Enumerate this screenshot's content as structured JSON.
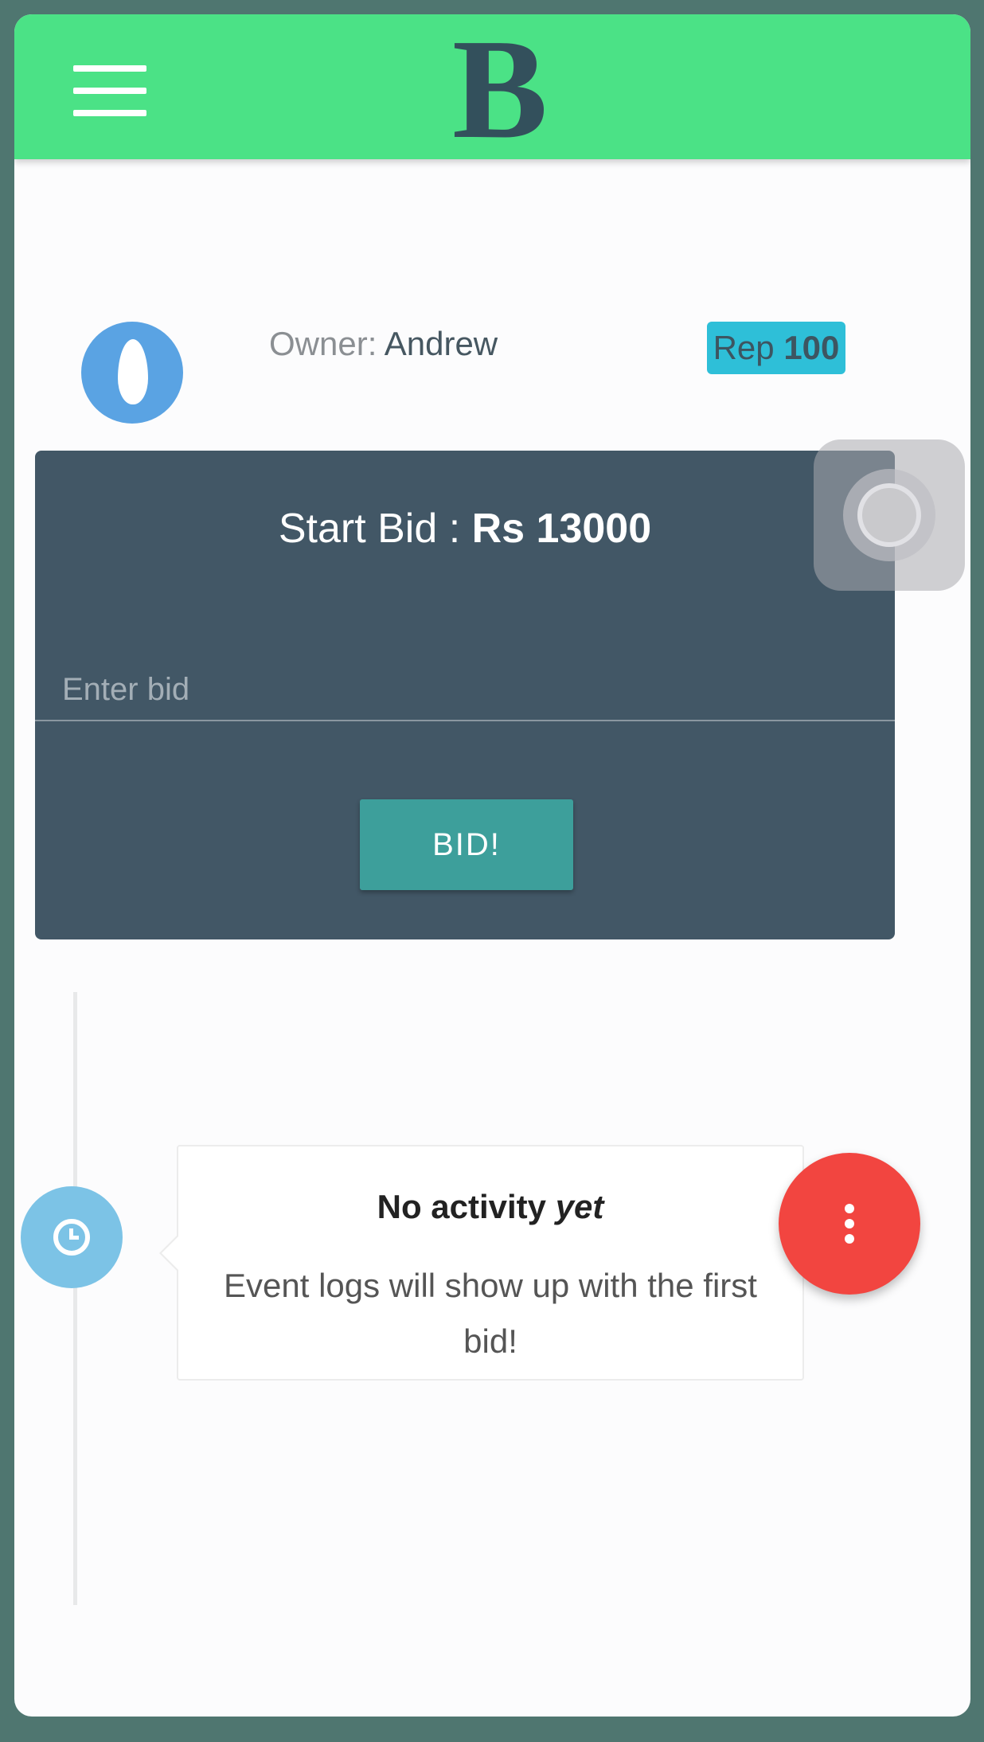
{
  "header": {
    "logo_text": "B",
    "menu_icon": "hamburger-menu-icon"
  },
  "owner": {
    "label": "Owner:",
    "name": "Andrew",
    "avatar_icon": "egg-avatar-icon"
  },
  "reputation": {
    "label": "Rep",
    "value": "100"
  },
  "bid": {
    "start_label": "Start Bid :",
    "start_amount": "Rs 13000",
    "input_placeholder": "Enter bid",
    "input_value": "",
    "button_label": "BID!"
  },
  "activity": {
    "icon": "clock-icon",
    "title_main": "No activity",
    "title_emphasis": "yet",
    "message": "Event logs will show up with the first bid!"
  },
  "fab": {
    "icon": "more-vertical-icon"
  },
  "colors": {
    "topbar": "#4be286",
    "logo": "#33505c",
    "bid_card": "#425766",
    "bid_button": "#3d9f9b",
    "rep_badge": "#2ebfd8",
    "fab": "#f24540",
    "timeline_icon": "#7cc3e6",
    "avatar": "#5aa3e3"
  }
}
